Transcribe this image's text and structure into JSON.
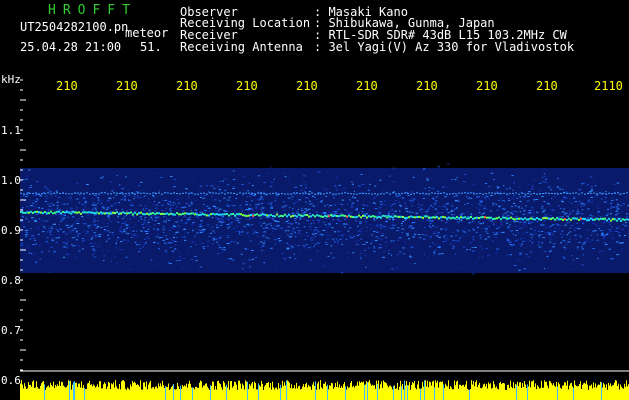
{
  "colors": {
    "background": "#000000",
    "label_text": "#ffffff",
    "brand_text": "#33cc33",
    "tick_text": "#ffff00",
    "histogram": "#ffff00",
    "axis_line": "#ffffff"
  },
  "header": {
    "brand": "HROFFT",
    "filename": "UT2504282100.pn",
    "meteor_label": "meteor",
    "datetime": "25.04.28 21:00",
    "count": "51."
  },
  "info": [
    {
      "label": "Observer",
      "value": ": Masaki Kano"
    },
    {
      "label": "Receiving Location",
      "value": ": Shibukawa, Gunma, Japan"
    },
    {
      "label": "Receiver",
      "value": ": RTL-SDR SDR# 43dB L15 103.2MHz CW"
    },
    {
      "label": "Receiving Antenna",
      "value": ": 3el Yagi(V) Az 330 for Vladivostok"
    }
  ],
  "x_ticks": [
    "210",
    "210",
    "210",
    "210",
    "210",
    "210",
    "210",
    "210",
    "210",
    "2110"
  ],
  "y_axis": {
    "unit": "kHz",
    "ticks": [
      "1.1",
      "1.0",
      "0.9",
      "0.8",
      "0.7",
      "0.6"
    ]
  }
}
